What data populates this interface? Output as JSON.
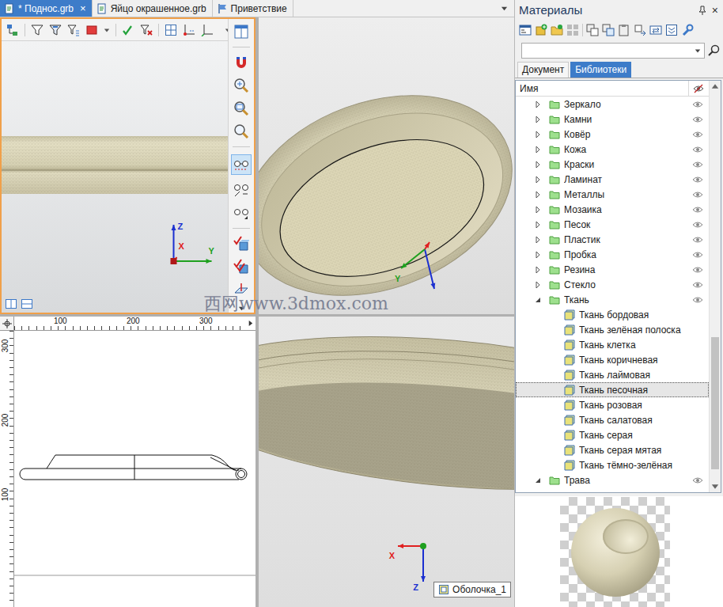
{
  "documentTabs": [
    {
      "label": "* Поднос.grb",
      "selected": true,
      "close": "×"
    },
    {
      "label": "Яйцо окрашенное.grb",
      "selected": false,
      "close": ""
    },
    {
      "label": "Приветствие",
      "selected": false,
      "close": ""
    }
  ],
  "views": {
    "front": {
      "active": true,
      "axes": [
        {
          "label": "Z",
          "color": "#1b2fd0"
        },
        {
          "label": "Y",
          "color": "#1ea01e"
        },
        {
          "label": "X",
          "color": "#e02020"
        }
      ]
    },
    "perspective": {
      "active": false,
      "axes": [
        {
          "label": "Y",
          "color": "#1ea01e"
        }
      ]
    },
    "drawing": {
      "active": false,
      "topRuler": [
        "100",
        "200",
        "300"
      ],
      "sideRuler": [
        "300",
        "200",
        "100"
      ]
    },
    "iso": {
      "active": false,
      "axes": [
        {
          "label": "X",
          "color": "#e02020"
        },
        {
          "label": "Z",
          "color": "#1b2fd0"
        }
      ],
      "object": "Оболочка_1"
    }
  },
  "watermark": "西网www.3dmox.com",
  "materials": {
    "title": "Материалы",
    "close": "×",
    "search": {
      "value": ""
    },
    "tabs": [
      {
        "label": "Документ",
        "selected": false
      },
      {
        "label": "Библиотеки",
        "selected": true
      }
    ],
    "columns": {
      "name": "Имя"
    },
    "scrollbar": {
      "offset": 0.63,
      "size": 0.34
    },
    "tree": [
      {
        "label": "Зеркало",
        "kind": "folder",
        "expanded": false,
        "selected": false
      },
      {
        "label": "Камни",
        "kind": "folder",
        "expanded": false,
        "selected": false
      },
      {
        "label": "Ковёр",
        "kind": "folder",
        "expanded": false,
        "selected": false
      },
      {
        "label": "Кожа",
        "kind": "folder",
        "expanded": false,
        "selected": false
      },
      {
        "label": "Краски",
        "kind": "folder",
        "expanded": false,
        "selected": false
      },
      {
        "label": "Ламинат",
        "kind": "folder",
        "expanded": false,
        "selected": false
      },
      {
        "label": "Металлы",
        "kind": "folder",
        "expanded": false,
        "selected": false
      },
      {
        "label": "Мозаика",
        "kind": "folder",
        "expanded": false,
        "selected": false
      },
      {
        "label": "Песок",
        "kind": "folder",
        "expanded": false,
        "selected": false
      },
      {
        "label": "Пластик",
        "kind": "folder",
        "expanded": false,
        "selected": false
      },
      {
        "label": "Пробка",
        "kind": "folder",
        "expanded": false,
        "selected": false
      },
      {
        "label": "Резина",
        "kind": "folder",
        "expanded": false,
        "selected": false
      },
      {
        "label": "Стекло",
        "kind": "folder",
        "expanded": false,
        "selected": false
      },
      {
        "label": "Ткань",
        "kind": "folder",
        "expanded": true,
        "selected": false
      },
      {
        "label": "Ткань бордовая",
        "kind": "material",
        "expanded": false,
        "selected": false
      },
      {
        "label": "Ткань зелёная полоска",
        "kind": "material",
        "expanded": false,
        "selected": false
      },
      {
        "label": "Ткань клетка",
        "kind": "material",
        "expanded": false,
        "selected": false
      },
      {
        "label": "Ткань коричневая",
        "kind": "material",
        "expanded": false,
        "selected": false
      },
      {
        "label": "Ткань лаймовая",
        "kind": "material",
        "expanded": false,
        "selected": false
      },
      {
        "label": "Ткань песочная",
        "kind": "material",
        "expanded": false,
        "selected": true
      },
      {
        "label": "Ткань розовая",
        "kind": "material",
        "expanded": false,
        "selected": false
      },
      {
        "label": "Ткань салатовая",
        "kind": "material",
        "expanded": false,
        "selected": false
      },
      {
        "label": "Ткань серая",
        "kind": "material",
        "expanded": false,
        "selected": false
      },
      {
        "label": "Ткань серая мятая",
        "kind": "material",
        "expanded": false,
        "selected": false
      },
      {
        "label": "Ткань тёмно-зелёная",
        "kind": "material",
        "expanded": false,
        "selected": false
      },
      {
        "label": "Трава",
        "kind": "folder",
        "expanded": true,
        "selected": false
      }
    ]
  }
}
